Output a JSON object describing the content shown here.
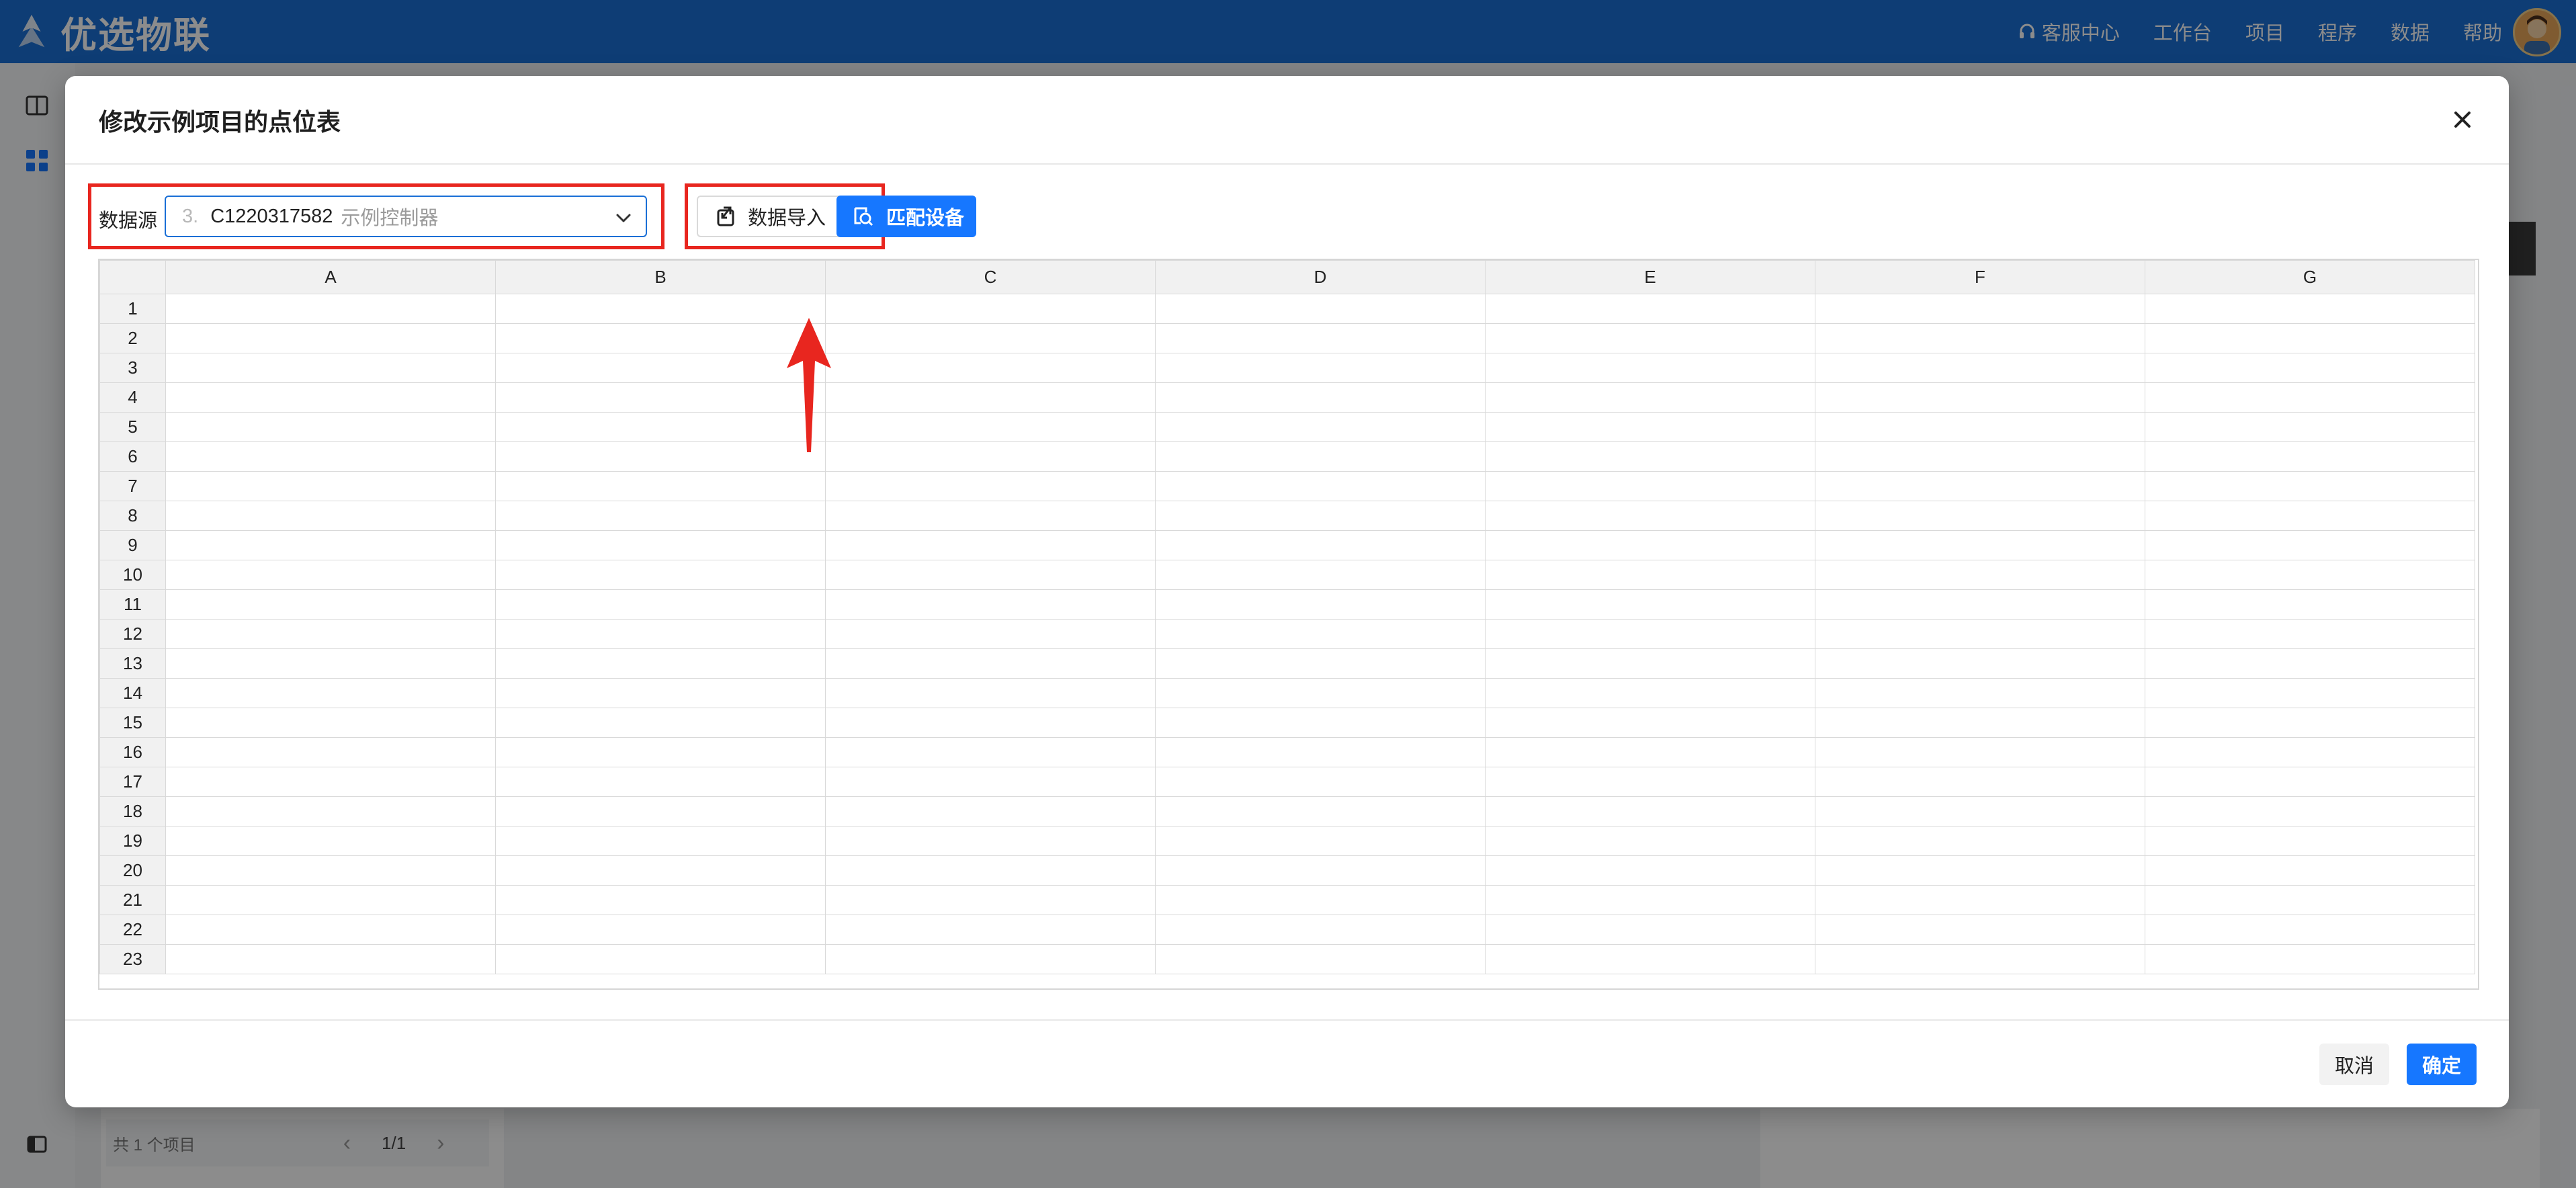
{
  "app": {
    "brand": "优选物联",
    "nav": [
      "客服中心",
      "工作台",
      "项目",
      "程序",
      "数据",
      "帮助"
    ]
  },
  "background": {
    "pager": {
      "total": "共 1 个项目",
      "page": "1/1"
    }
  },
  "modal": {
    "title": "修改示例项目的点位表",
    "source": {
      "label": "数据源",
      "index": "3.",
      "controller_id": "C1220317582",
      "controller_name": "示例控制器"
    },
    "import_label": "数据导入",
    "match_label": "匹配设备",
    "sheet": {
      "columns": [
        "A",
        "B",
        "C",
        "D",
        "E",
        "F",
        "G"
      ],
      "rows": [
        "1",
        "2",
        "3",
        "4",
        "5",
        "6",
        "7",
        "8",
        "9",
        "10",
        "11",
        "12",
        "13",
        "14",
        "15",
        "16",
        "17",
        "18",
        "19",
        "20",
        "21",
        "22",
        "23"
      ]
    },
    "cancel_label": "取消",
    "ok_label": "确定"
  },
  "colors": {
    "primary": "#1677ff",
    "topbar": "#1a6fd6",
    "highlight": "#e8261f"
  },
  "icons": [
    "brand-logo-icon",
    "headset-icon",
    "book-icon",
    "grid-icon",
    "sidebar-toggle-icon",
    "close-icon",
    "chevron-down-icon",
    "import-icon",
    "match-icon",
    "arrow-annotation"
  ]
}
